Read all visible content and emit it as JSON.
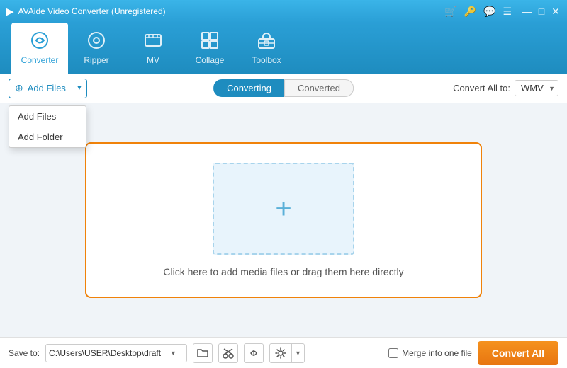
{
  "titleBar": {
    "title": "AVAide Video Converter (Unregistered)",
    "icons": [
      "🛒",
      "🔑",
      "💬",
      "☰",
      "—",
      "□",
      "✕"
    ]
  },
  "nav": {
    "items": [
      {
        "id": "converter",
        "label": "Converter",
        "icon": "⟳",
        "active": true
      },
      {
        "id": "ripper",
        "label": "Ripper",
        "icon": "⊙"
      },
      {
        "id": "mv",
        "label": "MV",
        "icon": "🖼"
      },
      {
        "id": "collage",
        "label": "Collage",
        "icon": "⊞"
      },
      {
        "id": "toolbox",
        "label": "Toolbox",
        "icon": "🧰"
      }
    ]
  },
  "toolbar": {
    "addFilesLabel": "Add Files",
    "dropdownItems": [
      "Add Files",
      "Add Folder"
    ],
    "tabs": [
      {
        "id": "converting",
        "label": "Converting",
        "active": true
      },
      {
        "id": "converted",
        "label": "Converted",
        "active": false
      }
    ],
    "convertAllToLabel": "Convert All to:",
    "selectedFormat": "WMV"
  },
  "mainContent": {
    "dropText": "Click here to add media files or drag them here directly"
  },
  "footer": {
    "saveToLabel": "Save to:",
    "savePath": "C:\\Users\\USER\\Desktop\\draft",
    "mergeLabel": "Merge into one file",
    "convertAllLabel": "Convert All"
  }
}
